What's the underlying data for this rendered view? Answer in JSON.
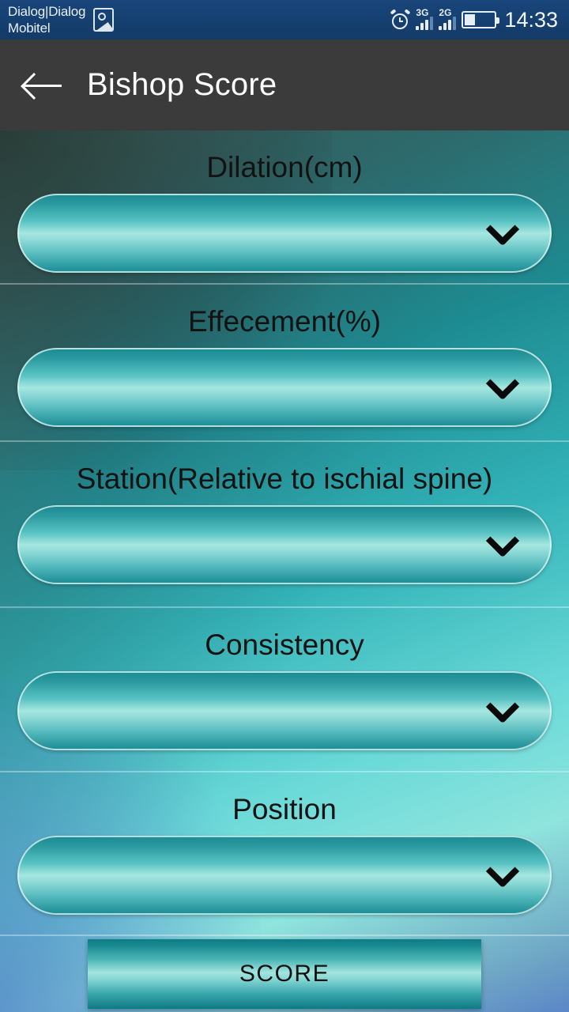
{
  "status_bar": {
    "carrier_line1": "Dialog|Dialog",
    "carrier_line2": "Mobitel",
    "screenshot_icon": "screenshot-icon",
    "alarm_icon": "alarm-clock-icon",
    "sim1_network": "3G",
    "sim2_network": "2G",
    "battery_icon": "battery-icon",
    "clock": "14:33",
    "background_color": "#17406f"
  },
  "app_bar": {
    "back_icon": "back-arrow-icon",
    "title": "Bishop Score",
    "background_color": "#3b3b3b"
  },
  "form": {
    "fields": [
      {
        "label": "Dilation(cm)",
        "value": "",
        "dropdown_icon": "chevron-down-icon"
      },
      {
        "label": "Effecement(%)",
        "value": "",
        "dropdown_icon": "chevron-down-icon"
      },
      {
        "label": "Station(Relative to ischial spine)",
        "value": "",
        "dropdown_icon": "chevron-down-icon"
      },
      {
        "label": "Consistency",
        "value": "",
        "dropdown_icon": "chevron-down-icon"
      },
      {
        "label": "Position",
        "value": "",
        "dropdown_icon": "chevron-down-icon"
      }
    ],
    "submit_label": "SCORE"
  },
  "theme": {
    "spinner_light": "#a6e6e0",
    "spinner_dark": "#1c8c93",
    "background_top": "#3f5f58",
    "background_mid": "#33b3b8",
    "background_bottom": "#5b86c8",
    "label_color": "#121212"
  }
}
